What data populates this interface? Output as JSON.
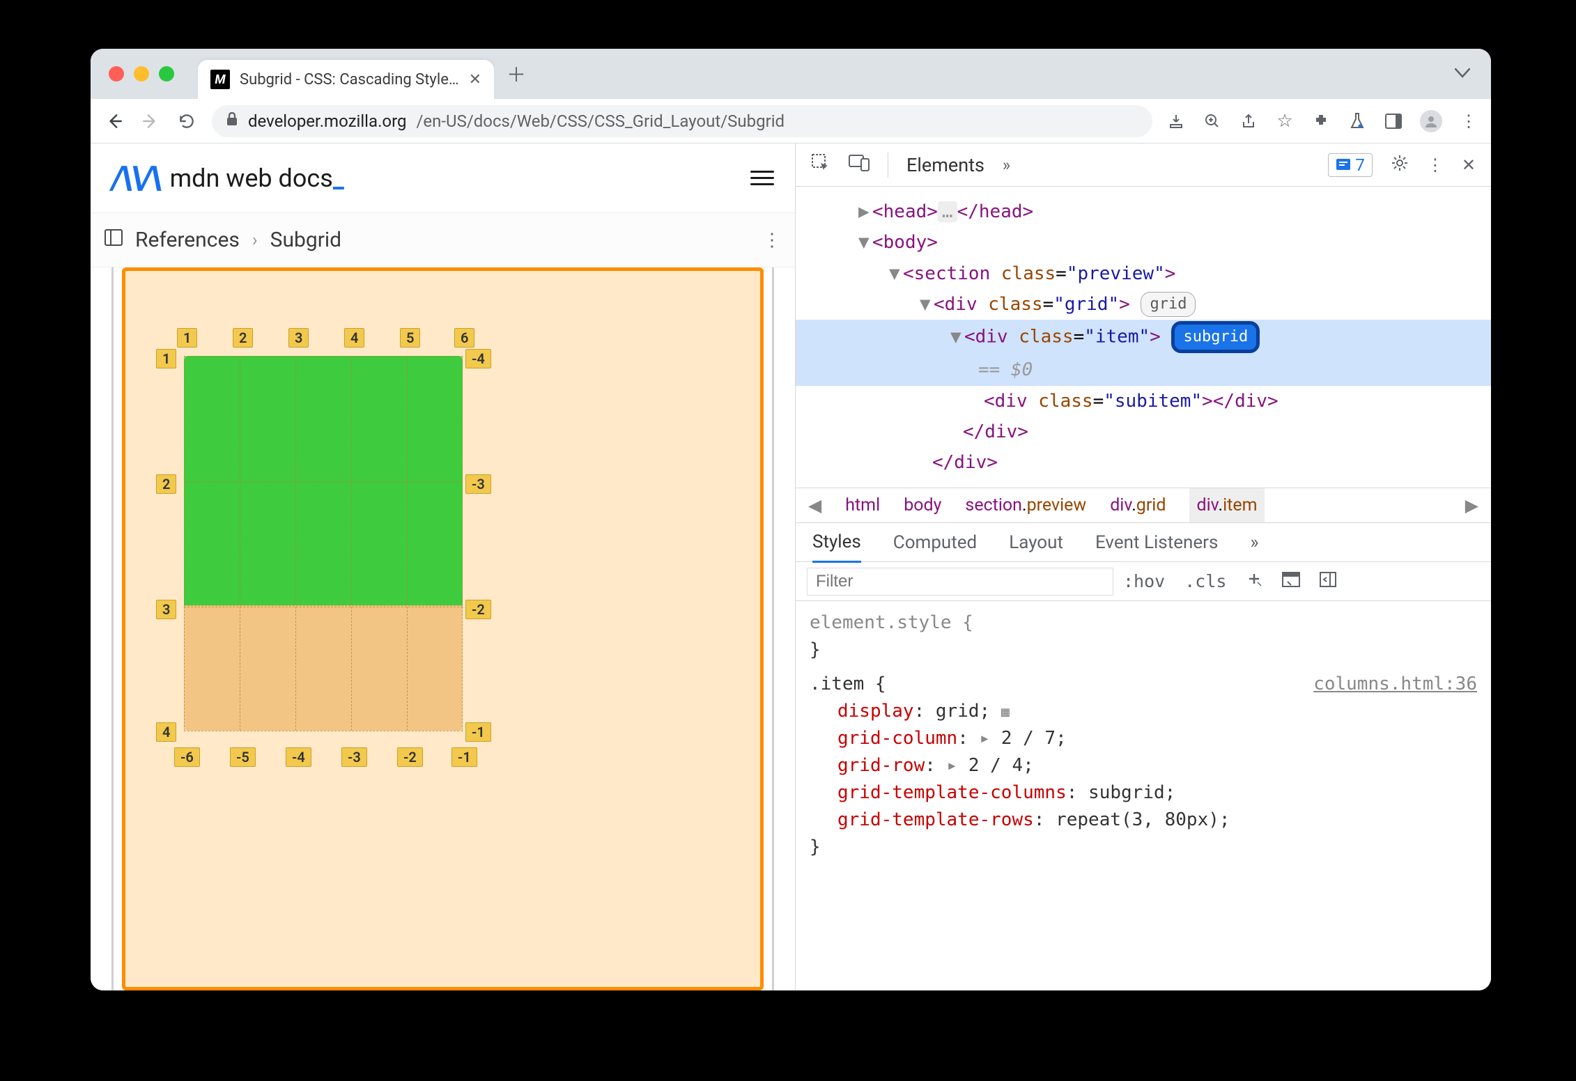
{
  "browser": {
    "tab_title": "Subgrid - CSS: Cascading Style…",
    "url_domain": "developer.mozilla.org",
    "url_path": "/en-US/docs/Web/CSS/CSS_Grid_Layout/Subgrid"
  },
  "mdn": {
    "logo_text": "mdn web docs",
    "underscore": "_",
    "breadcrumb": {
      "root": "References",
      "current": "Subgrid"
    }
  },
  "grid_labels": {
    "top": [
      "1",
      "2",
      "3",
      "4",
      "5",
      "6"
    ],
    "left": [
      "1",
      "2",
      "3",
      "4"
    ],
    "right": [
      "-4",
      "-3",
      "-2",
      "-1"
    ],
    "bottom": [
      "-6",
      "-5",
      "-4",
      "-3",
      "-2",
      "-1"
    ]
  },
  "devtools": {
    "panel": "Elements",
    "issues_count": "7",
    "dom": {
      "head_open": "<head>",
      "head_close": "</head>",
      "head_ellipsis": "…",
      "body_open": "<body>",
      "section": {
        "tag": "section",
        "class_attr": "class",
        "class_val": "preview"
      },
      "grid": {
        "tag": "div",
        "class_val": "grid",
        "badge": "grid"
      },
      "item": {
        "tag": "div",
        "class_val": "item",
        "badge": "subgrid",
        "eq": "== $0"
      },
      "subitem_line": "<div class=\"subitem\"></div>",
      "close_div1": "</div>",
      "close_div2": "</div>"
    },
    "crumbs": [
      "html",
      "body",
      "section.preview",
      "div.grid",
      "div.item"
    ],
    "style_tabs": [
      "Styles",
      "Computed",
      "Layout",
      "Event Listeners"
    ],
    "filter_placeholder": "Filter",
    "hov": ":hov",
    "cls": ".cls",
    "element_style": "element.style {",
    "rule_selector": ".item {",
    "rule_source": "columns.html:36",
    "rules": [
      {
        "prop": "display",
        "val": "grid;"
      },
      {
        "prop": "grid-column",
        "val": "2 / 7;",
        "tri": true
      },
      {
        "prop": "grid-row",
        "val": "2 / 4;",
        "tri": true
      },
      {
        "prop": "grid-template-columns",
        "val": "subgrid;"
      },
      {
        "prop": "grid-template-rows",
        "val": "repeat(3, 80px);"
      }
    ],
    "close_brace": "}"
  }
}
